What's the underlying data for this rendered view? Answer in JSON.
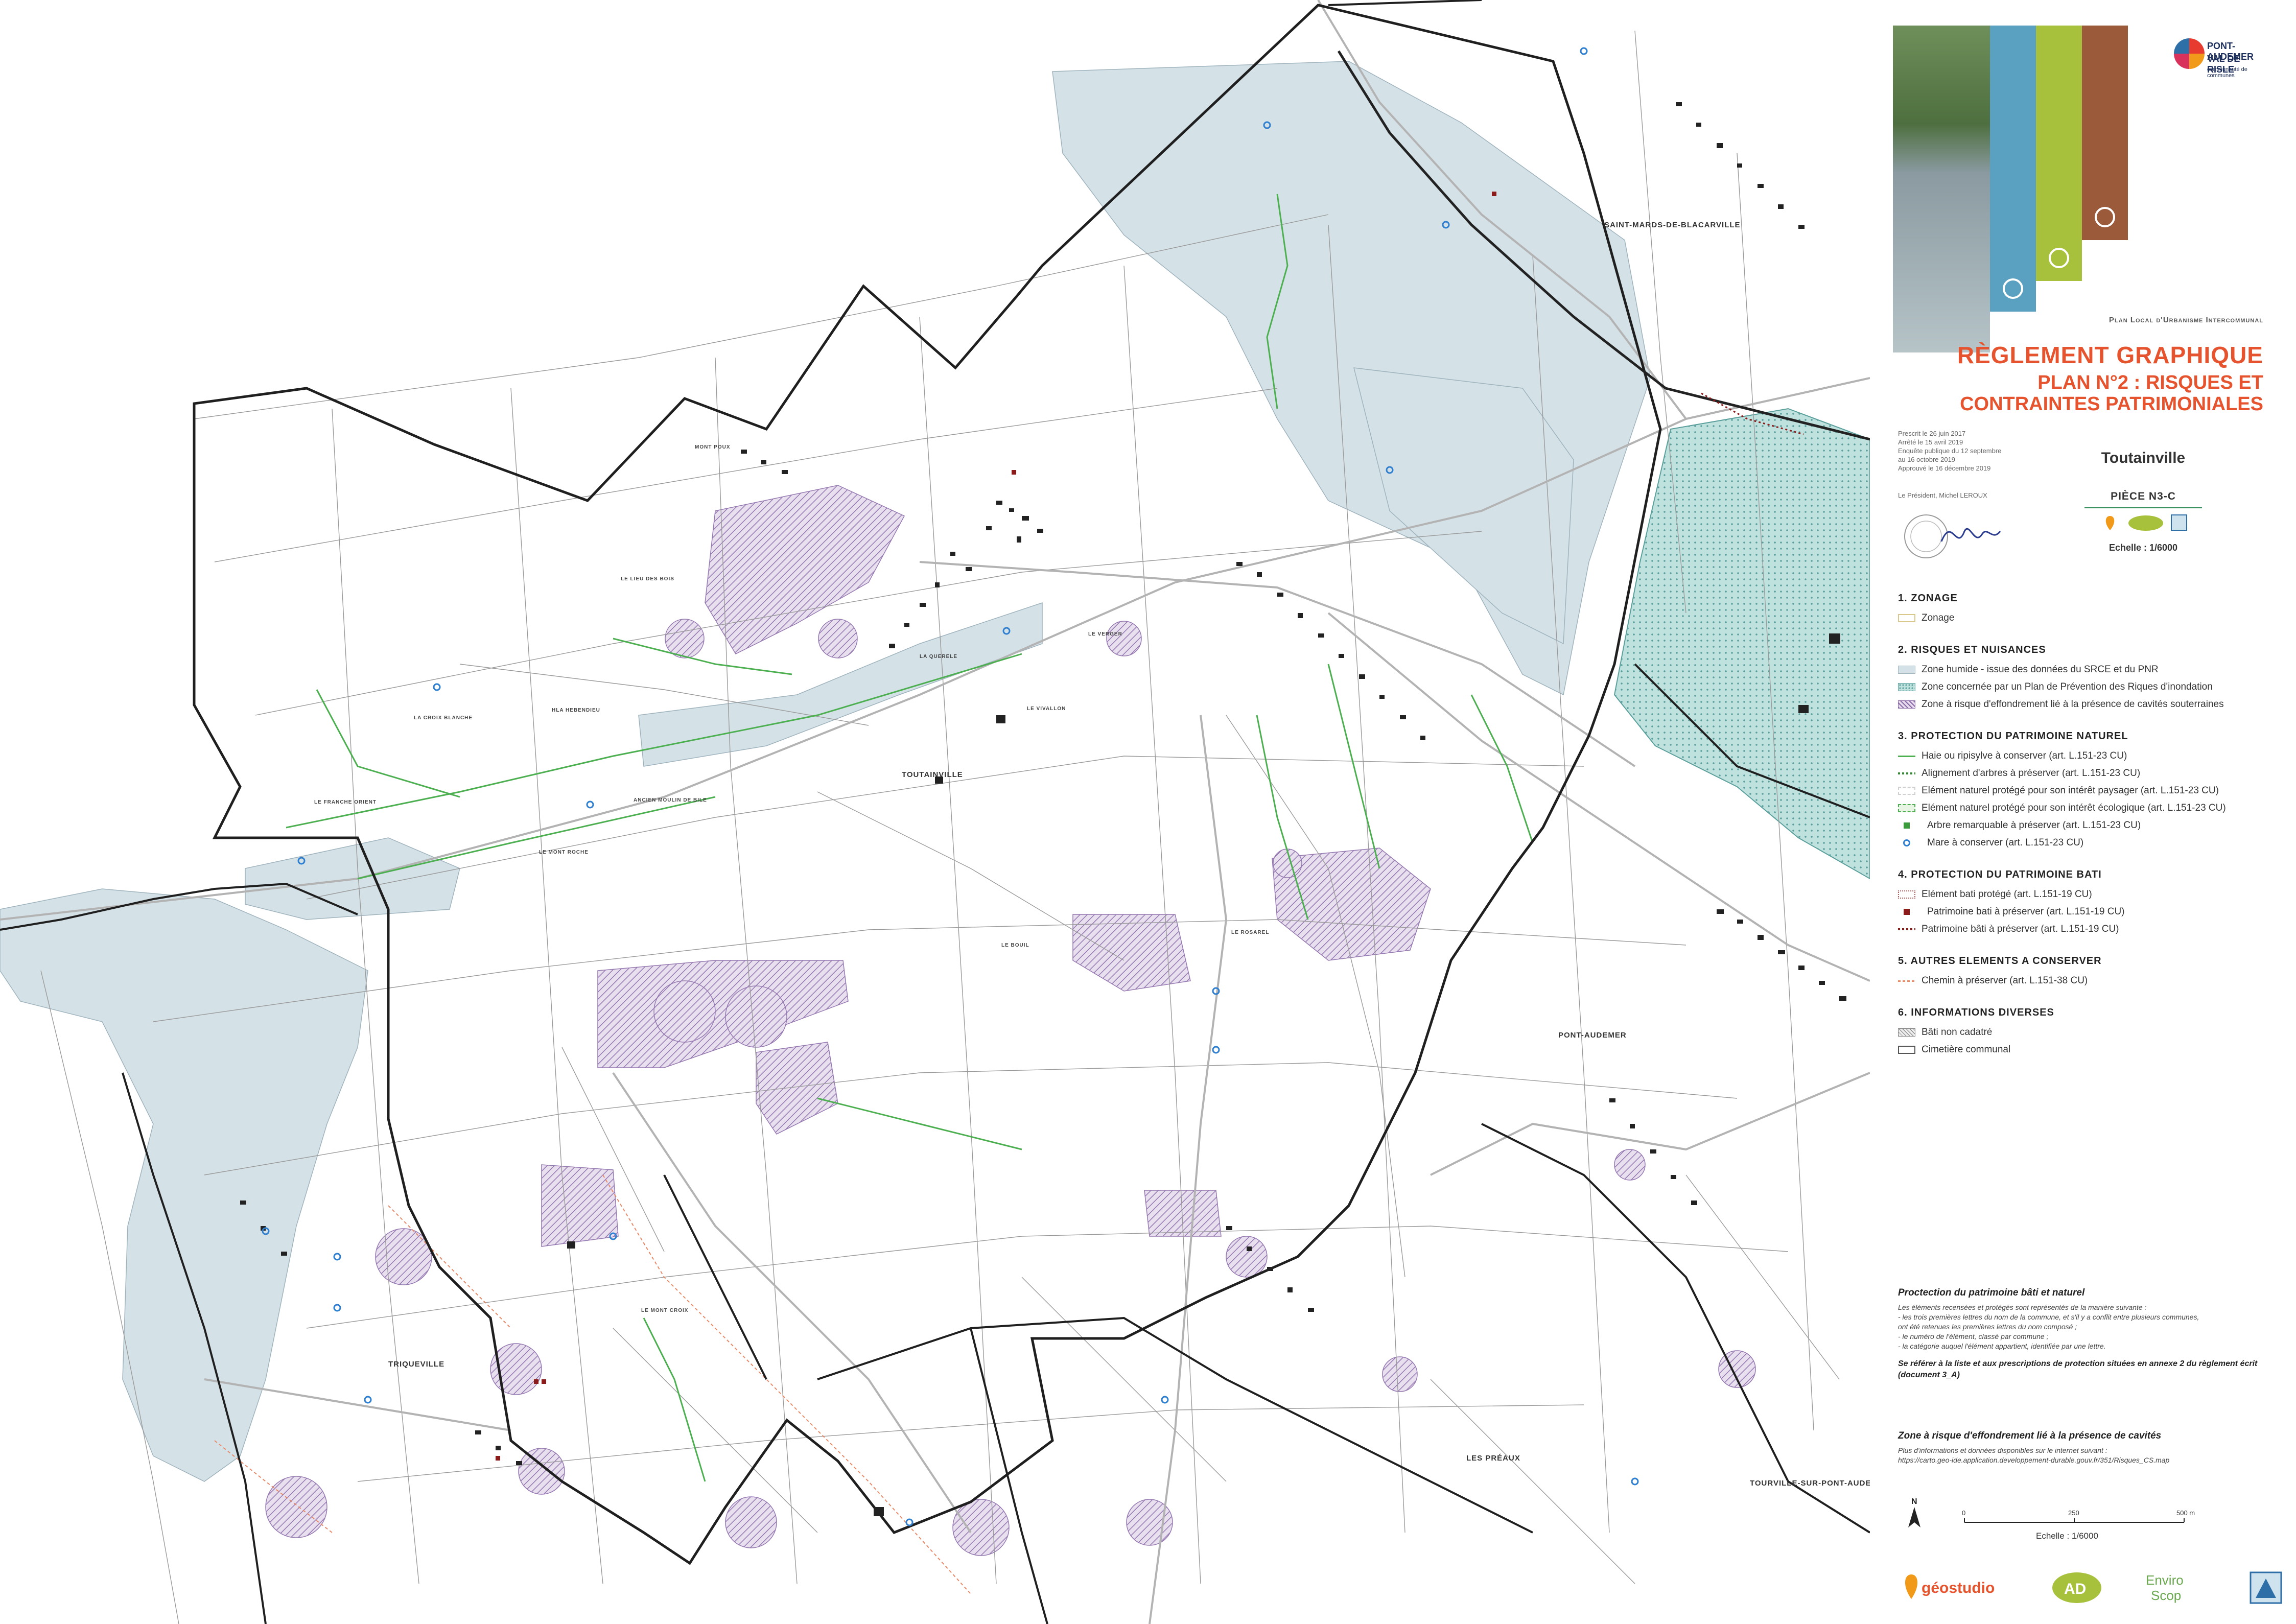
{
  "map": {
    "place_names": [
      "SAINT-MARDS-DE-BLACARVILLE",
      "TOUTAINVILLE",
      "PONT-AUDEMER",
      "TRIQUEVILLE",
      "LES PRÉAUX",
      "TOURVILLE-SUR-PONT-AUDEMER"
    ],
    "hamlet_names": [
      "LE LIEU DES BOIS",
      "LA CROIX BLANCHE",
      "HLA HEBENDIEU",
      "LE FRANCHE ORIENT",
      "ANCIEN MOULIN DE BILE",
      "LE MONT ROCHE",
      "LE MONT CROIX",
      "LA QUERELE",
      "LE VERGER",
      "LE VIVALLON",
      "LE ROSAREL",
      "LE BOUIL",
      "MONT POUX"
    ],
    "colors": {
      "boundary": "#1f1f1f",
      "parcel": "#8a8a8a",
      "road": "#b0b0b0",
      "hedge": "#4caf50",
      "wetland": "#cfdde4",
      "ppri": "#a9d5d2",
      "cavity": "#8a6ba8",
      "pond": "#2f7fd1",
      "heritage": "#8b1a1a",
      "building": "#222222"
    }
  },
  "panel": {
    "logo": {
      "line1": "PONT-AUDEMER",
      "line2": "VAL DE RISLE",
      "line3": "communauté de communes"
    },
    "plu_title": "Plan Local d'Urbanisme Intercommunal",
    "reglement_title": "RÈGLEMENT GRAPHIQUE",
    "plan_line1": "PLAN N°2 : RISQUES ET",
    "plan_line2": "CONTRAINTES PATRIMONIALES",
    "dates": [
      "Prescrit le 26 juin 2017",
      "Arrêté le 15 avril 2019",
      "Enquête publique du 12 septembre",
      "au 16 octobre 2019",
      "Approuvé le 16 décembre 2019"
    ],
    "president": "Le Président, Michel LEROUX",
    "commune": "Toutainville",
    "piece": "PIÈCE N3-C",
    "scale_label": "Echelle : 1/6000",
    "legend": [
      {
        "title": "1. ZONAGE",
        "items": [
          {
            "label": "Zonage",
            "icon": "zonage-swatch"
          }
        ]
      },
      {
        "title": "2. RISQUES ET NUISANCES",
        "items": [
          {
            "label": "Zone humide - issue des données du SRCE et du PNR",
            "icon": "wetland-swatch"
          },
          {
            "label": "Zone concernée par un Plan de Prévention des Riques d'inondation",
            "icon": "ppri-swatch"
          },
          {
            "label": "Zone à risque d'effondrement lié à la présence de cavités souterraines",
            "icon": "cavity-swatch"
          }
        ]
      },
      {
        "title": "3. PROTECTION DU PATRIMOINE NATUREL",
        "items": [
          {
            "label": "Haie ou ripisylve à conserver (art. L.151-23 CU)",
            "icon": "hedge-line"
          },
          {
            "label": "Alignement d'arbres à préserver (art. L.151-23 CU)",
            "icon": "tree-alignment"
          },
          {
            "label": "Elément naturel protégé pour son intérêt paysager (art. L.151-23 CU)",
            "icon": "landscape-swatch"
          },
          {
            "label": "Elément naturel protégé pour son intérêt écologique (art. L.151-23 CU)",
            "icon": "ecological-swatch"
          },
          {
            "label": "Arbre remarquable à préserver (art. L.151-23 CU)",
            "icon": "remarkable-tree"
          },
          {
            "label": "Mare à conserver (art. L.151-23 CU)",
            "icon": "pond-circle"
          }
        ]
      },
      {
        "title": "4. PROTECTION DU PATRIMOINE BATI",
        "items": [
          {
            "label": "Elément bati protégé (art. L.151-19 CU)",
            "icon": "protected-building"
          },
          {
            "label": "Patrimoine bati à préserver (art. L.151-19 CU)",
            "icon": "heritage-square"
          },
          {
            "label": "Patrimoine bâti à préserver (art. L.151-19 CU)",
            "icon": "heritage-line"
          }
        ]
      },
      {
        "title": "5. AUTRES ELEMENTS A CONSERVER",
        "items": [
          {
            "label": "Chemin à préserver  (art. L.151-38 CU)",
            "icon": "path-line"
          }
        ]
      },
      {
        "title": "6. INFORMATIONS DIVERSES",
        "items": [
          {
            "label": "Bâti non cadatré",
            "icon": "uncadastred-swatch"
          },
          {
            "label": "Cimetière communal",
            "icon": "cemetery-swatch"
          }
        ]
      }
    ],
    "notes": {
      "heading": "Proctection du patrimoine bâti et naturel",
      "lines": [
        "Les éléments recensées et protégés sont représentés de la manière suivante :",
        "- les trois premières lettres du nom de la commune, et s'il y a conflit entre plusieurs communes,",
        "ont été retenues les premières lettres du nom composé ;",
        "- le numéro de l'élément, classé par commune ;",
        "- la catégorie auquel l'élément appartient, identifiée par une lettre."
      ],
      "bold": "Se référer à la liste et aux prescriptions de protection situées en annexe 2 du règlement écrit (document 3_A)"
    },
    "cavites": {
      "heading": "Zone à risque d'effondrement lié à la présence de cavités",
      "line1": "Plus d'informations et données disponibles sur le internet suivant :",
      "line2": "https://carto.geo-ide.application.developpement-durable.gouv.fr/351/Risques_CS.map"
    },
    "scalebar": {
      "n": "N",
      "t0": "0",
      "t1": "250",
      "t2": "500 m",
      "label": "Echelle : 1/6000"
    },
    "footer": {
      "geostudio": "géostudio",
      "ad": "AD",
      "enviro1": "Enviro",
      "enviro2": "Scop"
    }
  }
}
